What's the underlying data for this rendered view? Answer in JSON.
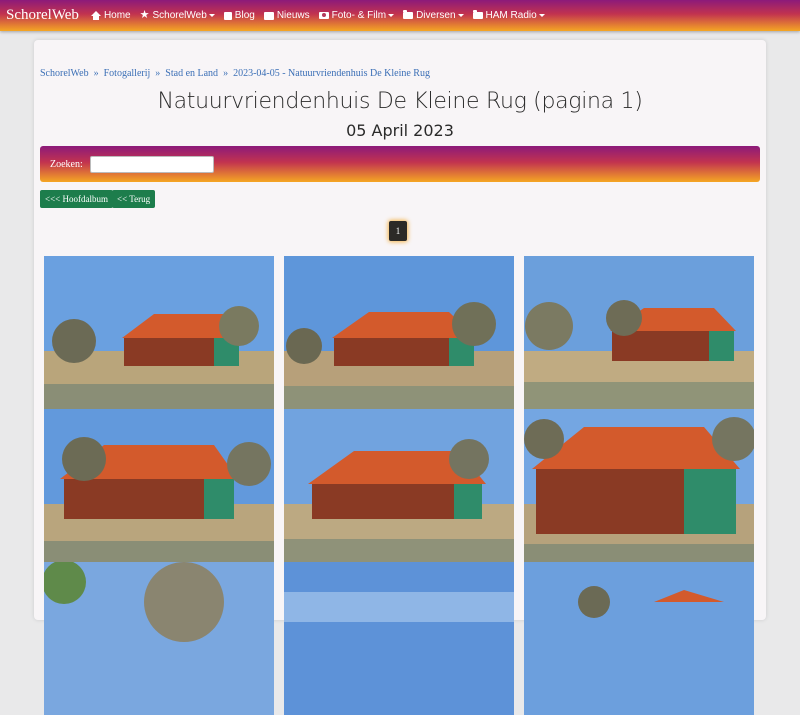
{
  "navbar": {
    "brand": "SchorelWeb",
    "items": [
      {
        "label": "Home",
        "icon": "home-icon",
        "dropdown": false
      },
      {
        "label": "SchorelWeb",
        "icon": "star-icon",
        "dropdown": true
      },
      {
        "label": "Blog",
        "icon": "rss-icon",
        "dropdown": false
      },
      {
        "label": "Nieuws",
        "icon": "newspaper-icon",
        "dropdown": false
      },
      {
        "label": "Foto- & Film",
        "icon": "camera-icon",
        "dropdown": true
      },
      {
        "label": "Diversen",
        "icon": "folder-icon",
        "dropdown": true
      },
      {
        "label": "HAM Radio",
        "icon": "folder-icon",
        "dropdown": true
      }
    ]
  },
  "breadcrumb": [
    "SchorelWeb",
    "Fotogallerij",
    "Stad en Land",
    "2023-04-05 - Natuurvriendenhuis De Kleine Rug"
  ],
  "breadcrumb_separator": "»",
  "page": {
    "title": "Natuurvriendenhuis De Kleine Rug (pagina 1)",
    "date": "05 April 2023"
  },
  "search": {
    "label": "Zoeken:",
    "value": ""
  },
  "buttons": {
    "main_album": "<<< Hoofdalbum",
    "back": "<< Terug"
  },
  "pagination": {
    "current": "1"
  },
  "colors": {
    "gradient_top": "#8c1a7a",
    "gradient_bottom": "#f5a623",
    "button_green": "#1d7d4c",
    "link_blue": "#3b6fb6"
  },
  "gallery": {
    "count_visible": 9
  }
}
